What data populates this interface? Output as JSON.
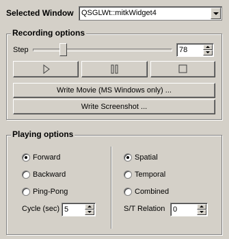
{
  "selected_window": {
    "label": "Selected Window",
    "value": "QSGLWt::mitkWidget4"
  },
  "recording": {
    "title": "Recording options",
    "step_label": "Step",
    "step_value": "78",
    "step_slider_fraction": 0.2,
    "controls": [
      "play",
      "pause",
      "stop"
    ],
    "write_movie_label": "Write Movie (MS Windows only) ...",
    "write_screenshot_label": "Write Screenshot ..."
  },
  "playing": {
    "title": "Playing options",
    "modes": [
      {
        "label": "Forward",
        "checked": true
      },
      {
        "label": "Backward",
        "checked": false
      },
      {
        "label": "Ping-Pong",
        "checked": false
      }
    ],
    "dimensions": [
      {
        "label": "Spatial",
        "checked": true
      },
      {
        "label": "Temporal",
        "checked": false
      },
      {
        "label": "Combined",
        "checked": false
      }
    ],
    "cycle_label": "Cycle (sec)",
    "cycle_value": "5",
    "st_relation_label": "S/T Relation",
    "st_relation_value": "0"
  }
}
